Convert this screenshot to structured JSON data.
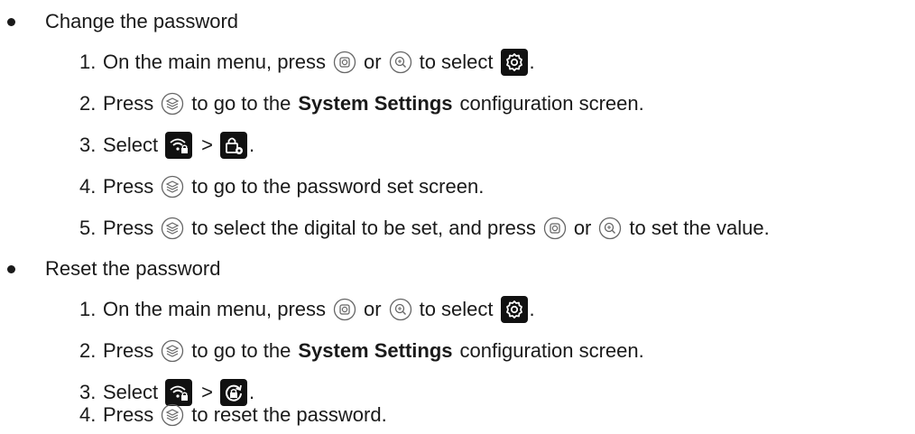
{
  "change": {
    "title": "Change the password",
    "step1": {
      "num": "1.",
      "a": "On the main menu, press",
      "or": "or",
      "b": "to select",
      "end": "."
    },
    "step2": {
      "num": "2.",
      "a": "Press",
      "b": "to go to the",
      "bold": "System Settings",
      "c": "configuration screen."
    },
    "step3": {
      "num": "3.",
      "a": "Select",
      "gt": ">",
      "end": "."
    },
    "step4": {
      "num": "4.",
      "a": "Press",
      "b": "to go to the password set screen."
    },
    "step5": {
      "num": "5.",
      "a": "Press",
      "b": "to select the digital to be set, and press",
      "or": "or",
      "c": "to set the value."
    }
  },
  "reset": {
    "title": "Reset the password",
    "step1": {
      "num": "1.",
      "a": "On the main menu, press",
      "or": "or",
      "b": "to select",
      "end": "."
    },
    "step2": {
      "num": "2.",
      "a": "Press",
      "b": "to go to the",
      "bold": "System Settings",
      "c": "configuration screen."
    },
    "step3": {
      "num": "3.",
      "a": "Select",
      "gt": ">",
      "end": "."
    },
    "step4": {
      "num": "4.",
      "a": "Press",
      "b": "to reset the password."
    }
  },
  "icons": {
    "capture": "capture-button-icon",
    "zoom": "zoom-button-icon",
    "menu": "menu-button-icon",
    "settings": "gear-icon",
    "wifi_lock": "wifi-lock-icon",
    "lock_config": "lock-settings-icon",
    "reset_lock": "reset-lock-icon"
  }
}
